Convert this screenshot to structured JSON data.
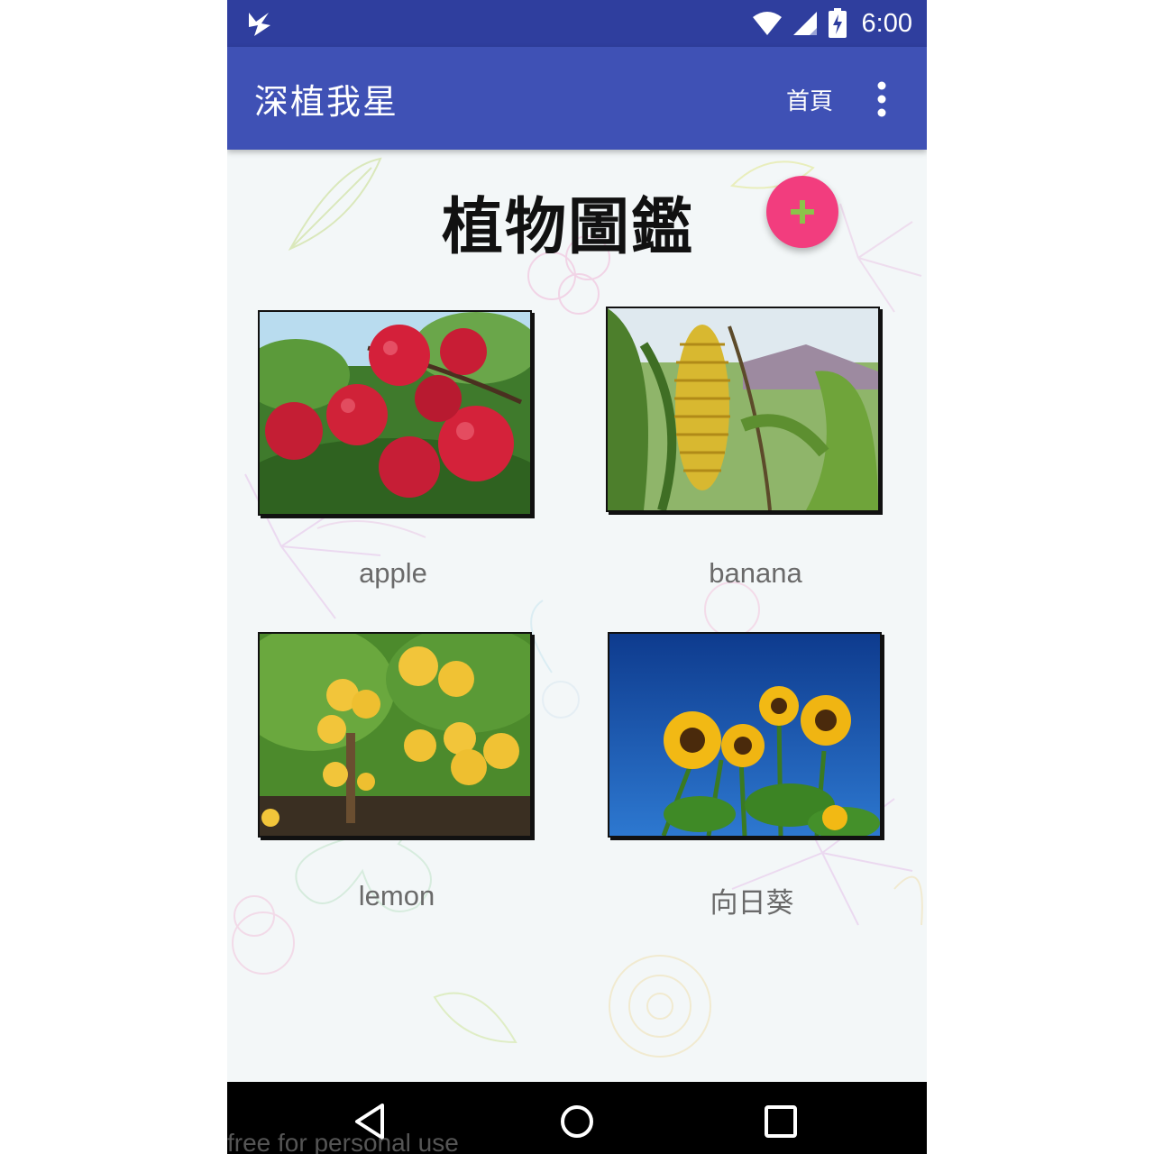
{
  "status_bar": {
    "time": "6:00",
    "icons": [
      "app-notification-icon",
      "wifi-icon",
      "cell-signal-icon",
      "battery-charging-icon"
    ]
  },
  "app_bar": {
    "title": "深植我星",
    "home_action": "首頁",
    "overflow_icon": "more-vert-icon"
  },
  "main": {
    "page_title": "植物圖鑑",
    "fab_icon": "plus-icon",
    "plants": [
      {
        "label": "apple",
        "image": "apple-tree-photo"
      },
      {
        "label": "banana",
        "image": "banana-plant-photo"
      },
      {
        "label": "lemon",
        "image": "lemon-tree-photo"
      },
      {
        "label": "向日葵",
        "image": "sunflower-photo"
      }
    ]
  },
  "nav_bar": {
    "icons": [
      "back-icon",
      "home-icon",
      "recents-icon"
    ]
  },
  "watermark": "free for personal use",
  "colors": {
    "status_bar": "#2f3e9e",
    "app_bar": "#3f51b5",
    "fab": "#f23d7e",
    "fab_icon": "#8bc34a",
    "background": "#f3f7f8"
  }
}
